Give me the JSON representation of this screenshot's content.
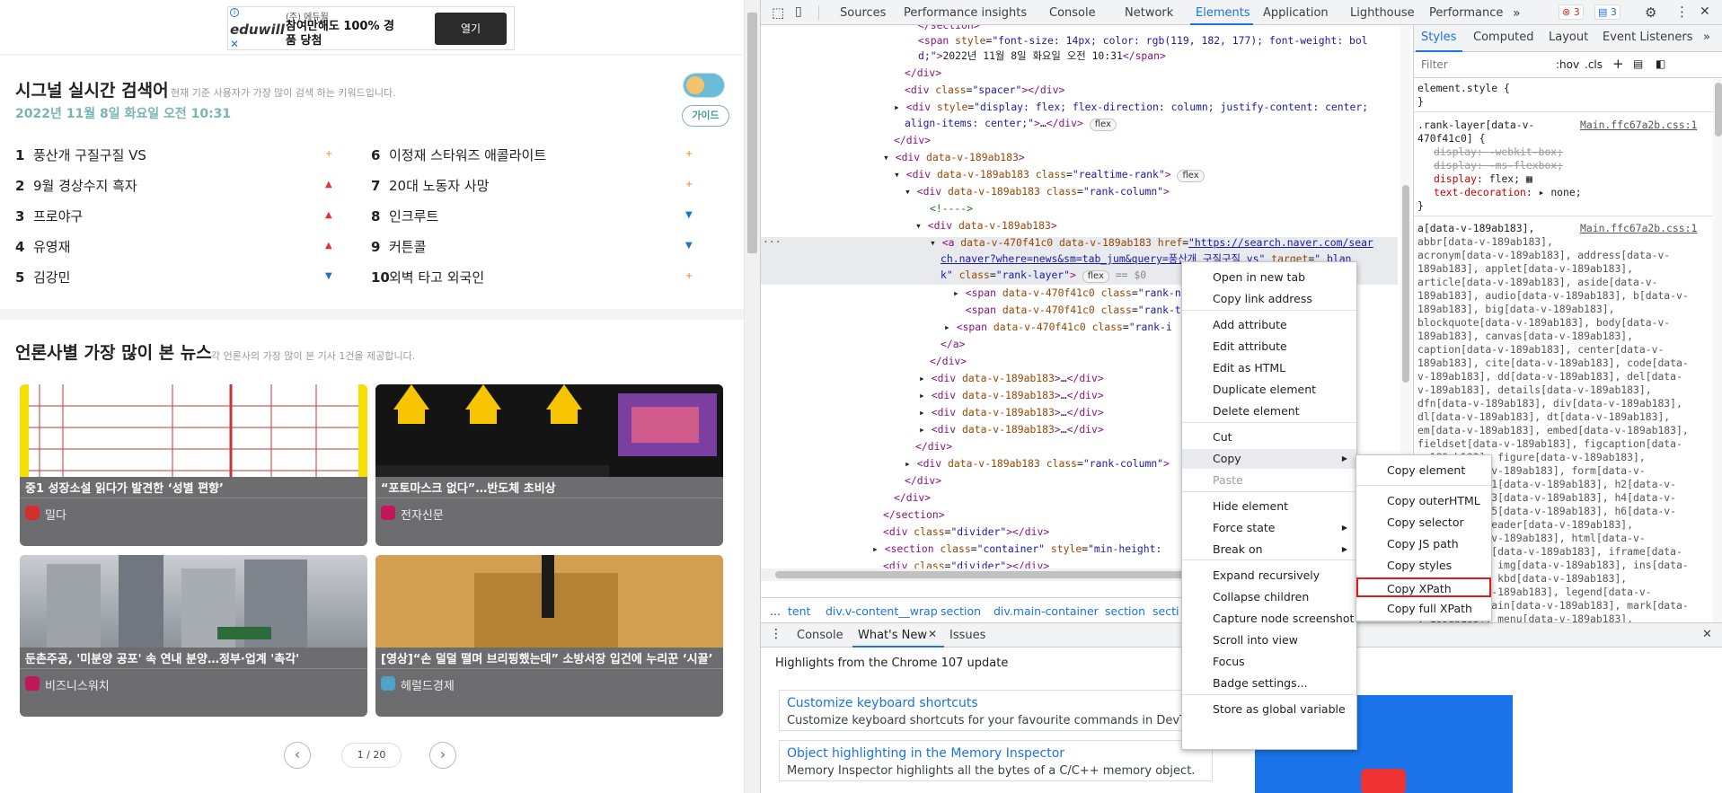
{
  "ad": {
    "small": "(주) 에듀윌",
    "headline": "참여만해도 100% 경품 당첨",
    "button": "열기",
    "brand": "eduwill"
  },
  "realtime": {
    "title": "시그널 실시간 검색어",
    "subtitle": "현재 기준 사용자가 가장 많이 검색 하는 키워드입니다.",
    "date": "2022년 11월 8일 화요일 오전 10:31",
    "guide": "가이드",
    "ranks": [
      {
        "n": "1",
        "text": "풍산개 구질구질 VS",
        "trend": "new"
      },
      {
        "n": "2",
        "text": "9월 경상수지 흑자",
        "trend": "up"
      },
      {
        "n": "3",
        "text": "프로야구",
        "trend": "up"
      },
      {
        "n": "4",
        "text": "유영재",
        "trend": "up"
      },
      {
        "n": "5",
        "text": "김강민",
        "trend": "down"
      },
      {
        "n": "6",
        "text": "이정재 스타워즈 애콜라이트",
        "trend": "new"
      },
      {
        "n": "7",
        "text": "20대 노동자 사망",
        "trend": "new"
      },
      {
        "n": "8",
        "text": "인크루트",
        "trend": "down"
      },
      {
        "n": "9",
        "text": "커튼콜",
        "trend": "down"
      },
      {
        "n": "10",
        "text": "외벽 타고 외국인",
        "trend": "new"
      }
    ]
  },
  "news": {
    "title": "언론사별 가장 많이 본 뉴스",
    "subtitle": "각 언론사의 가장 많이 본 기사 1건을 제공합니다.",
    "cards": [
      {
        "title": "중1 성장소설 읽다가 발견한 ‘성별 편향’",
        "press": "밀다",
        "logo_color": "#d32f2f"
      },
      {
        "title": "“포토마스크 없다”…반도체 초비상",
        "press": "전자신문",
        "logo_color": "#c2185b"
      },
      {
        "title": "둔촌주공, '미분양 공포' 속 연내 분양…정부·업계 '촉각'",
        "press": "비즈니스워치",
        "logo_color": "#c2185b"
      },
      {
        "title": "[영상]“손 덜덜 떨며 브리핑했는데” 소방서장 입건에 누리꾼 ‘시끌’",
        "press": "헤럴드경제",
        "logo_color": "#4fa3c7"
      }
    ],
    "pager": "1 / 20"
  },
  "devtools": {
    "tabs": [
      "Sources",
      "Performance insights",
      "Console",
      "Network",
      "Elements",
      "Application",
      "Lighthouse",
      "Performance"
    ],
    "active_tab": "Elements",
    "errors": "3",
    "messages": "3",
    "dom": {
      "date_text": "2022년 11월 8일 화요일 오전 10:31",
      "href": "https://search.naver.com/search.naver?where=news&sm=tab_jum&query=풍산개 구질구질 vs",
      "eq": "== $0"
    },
    "crumbs": [
      "...",
      "tent",
      "div.v-content__wrap",
      "section",
      "div.main-container",
      "section",
      "secti"
    ],
    "styles_tabs": [
      "Styles",
      "Computed",
      "Layout",
      "Event Listeners"
    ],
    "filter_placeholder": "Filter",
    "hov": ":hov",
    "cls": ".cls",
    "source": "Main.ffc67a2b.css:1",
    "drawer_tabs": [
      "Console",
      "What's New",
      "Issues"
    ],
    "whats_new_heading": "Highlights from the Chrome 107 update",
    "whats_new": [
      {
        "h": "Customize keyboard shortcuts",
        "p": "Customize keyboard shortcuts for your favourite commands in DevTools."
      },
      {
        "h": "Object highlighting in the Memory Inspector",
        "p": "Memory Inspector highlights all the bytes of a C/C++ memory object."
      }
    ],
    "context_menu": [
      "Open in new tab",
      "Copy link address",
      "Add attribute",
      "Edit attribute",
      "Edit as HTML",
      "Duplicate element",
      "Delete element",
      "Cut",
      "Copy",
      "Paste",
      "Hide element",
      "Force state",
      "Break on",
      "Expand recursively",
      "Collapse children",
      "Capture node screenshot",
      "Scroll into view",
      "Focus",
      "Badge settings...",
      "Store as global variable"
    ],
    "copy_submenu": [
      "Copy element",
      "Copy outerHTML",
      "Copy selector",
      "Copy JS path",
      "Copy styles",
      "Copy XPath",
      "Copy full XPath"
    ]
  }
}
